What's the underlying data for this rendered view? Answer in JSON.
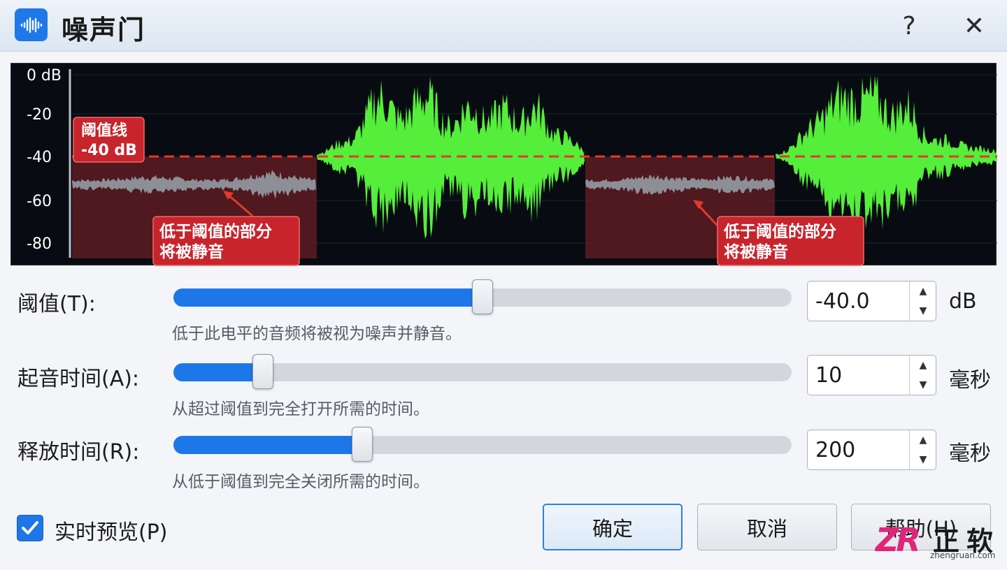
{
  "window": {
    "title": "噪声门",
    "help_glyph": "?",
    "close_glyph": "✕"
  },
  "waveform": {
    "y_axis_labels": [
      "0 dB",
      "-20",
      "-40",
      "-60",
      "-80"
    ],
    "threshold_label": [
      "阈值线",
      "-40 dB"
    ],
    "callouts": [
      [
        "低于阈值的部分",
        "将被静音"
      ],
      [
        "低于阈值的部分",
        "将被静音"
      ]
    ],
    "colors": {
      "active_wave": "#55ee3a",
      "gated_wave": "#8d8f96",
      "gated_region": "#5c1c22",
      "threshold_line": "#e23a2c",
      "callout_bg": "#c8242c"
    }
  },
  "params": [
    {
      "label": "阈值(T):",
      "hint": "低于此电平的音频将被视为噪声并静音。",
      "value": "-40.0",
      "unit": "dB",
      "position": 0.5
    },
    {
      "label": "起音时间(A):",
      "hint": "从超过阈值到完全打开所需的时间。",
      "value": "10",
      "unit": "毫秒",
      "position": 0.145
    },
    {
      "label": "释放时间(R):",
      "hint": "从低于阈值到完全关闭所需的时间。",
      "value": "200",
      "unit": "毫秒",
      "position": 0.305
    }
  ],
  "preview": {
    "label": "实时预览(P)",
    "checked": true
  },
  "buttons": {
    "ok": "确定",
    "cancel": "取消",
    "help": "帮助(H)"
  },
  "watermark": {
    "logo": "ZR",
    "name": "正软",
    "url": "zhengruan.com"
  }
}
